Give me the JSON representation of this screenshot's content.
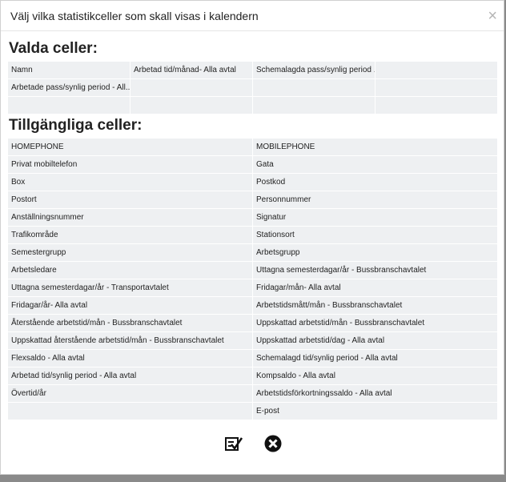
{
  "dialog": {
    "title": "Välj vilka statistikceller som skall visas i kalendern",
    "close_glyph": "×"
  },
  "selected": {
    "heading": "Valda celler:",
    "cells": [
      "Namn",
      "Arbetad tid/månad- Alla avtal",
      "Schemalagda pass/synlig period ...",
      "",
      "Arbetade pass/synlig period - All...",
      "",
      "",
      "",
      "",
      "",
      "",
      ""
    ]
  },
  "available": {
    "heading": "Tillgängliga celler:",
    "cells": [
      "HOMEPHONE",
      "MOBILEPHONE",
      "Privat mobiltelefon",
      "Gata",
      "Box",
      "Postkod",
      "Postort",
      "Personnummer",
      "Anställningsnummer",
      "Signatur",
      "Trafikområde",
      "Stationsort",
      "Semestergrupp",
      "Arbetsgrupp",
      "Arbetsledare",
      "Uttagna semesterdagar/år - Bussbranschavtalet",
      "Uttagna semesterdagar/år - Transportavtalet",
      "Fridagar/mån- Alla avtal",
      "Fridagar/år- Alla avtal",
      "Arbetstidsmått/mån - Bussbranschavtalet",
      "Återstående arbetstid/mån - Bussbranschavtalet",
      "Uppskattad arbetstid/mån - Bussbranschavtalet",
      "Uppskattad återstående arbetstid/mån - Bussbranschavtalet",
      "Uppskattad arbetstid/dag - Alla avtal",
      "Flexsaldo - Alla avtal",
      "Schemalagd tid/synlig period - Alla avtal",
      "Arbetad tid/synlig period - Alla avtal",
      "Kompsaldo - Alla avtal",
      "Övertid/år",
      "Arbetstidsförkortningssaldo - Alla avtal",
      "",
      "E-post"
    ]
  },
  "footer": {
    "confirm_icon": "checklist-confirm-icon",
    "cancel_icon": "circle-x-cancel-icon"
  },
  "colors": {
    "cell_bg": "#eef0f2",
    "overlay": "#8a8a8a"
  }
}
